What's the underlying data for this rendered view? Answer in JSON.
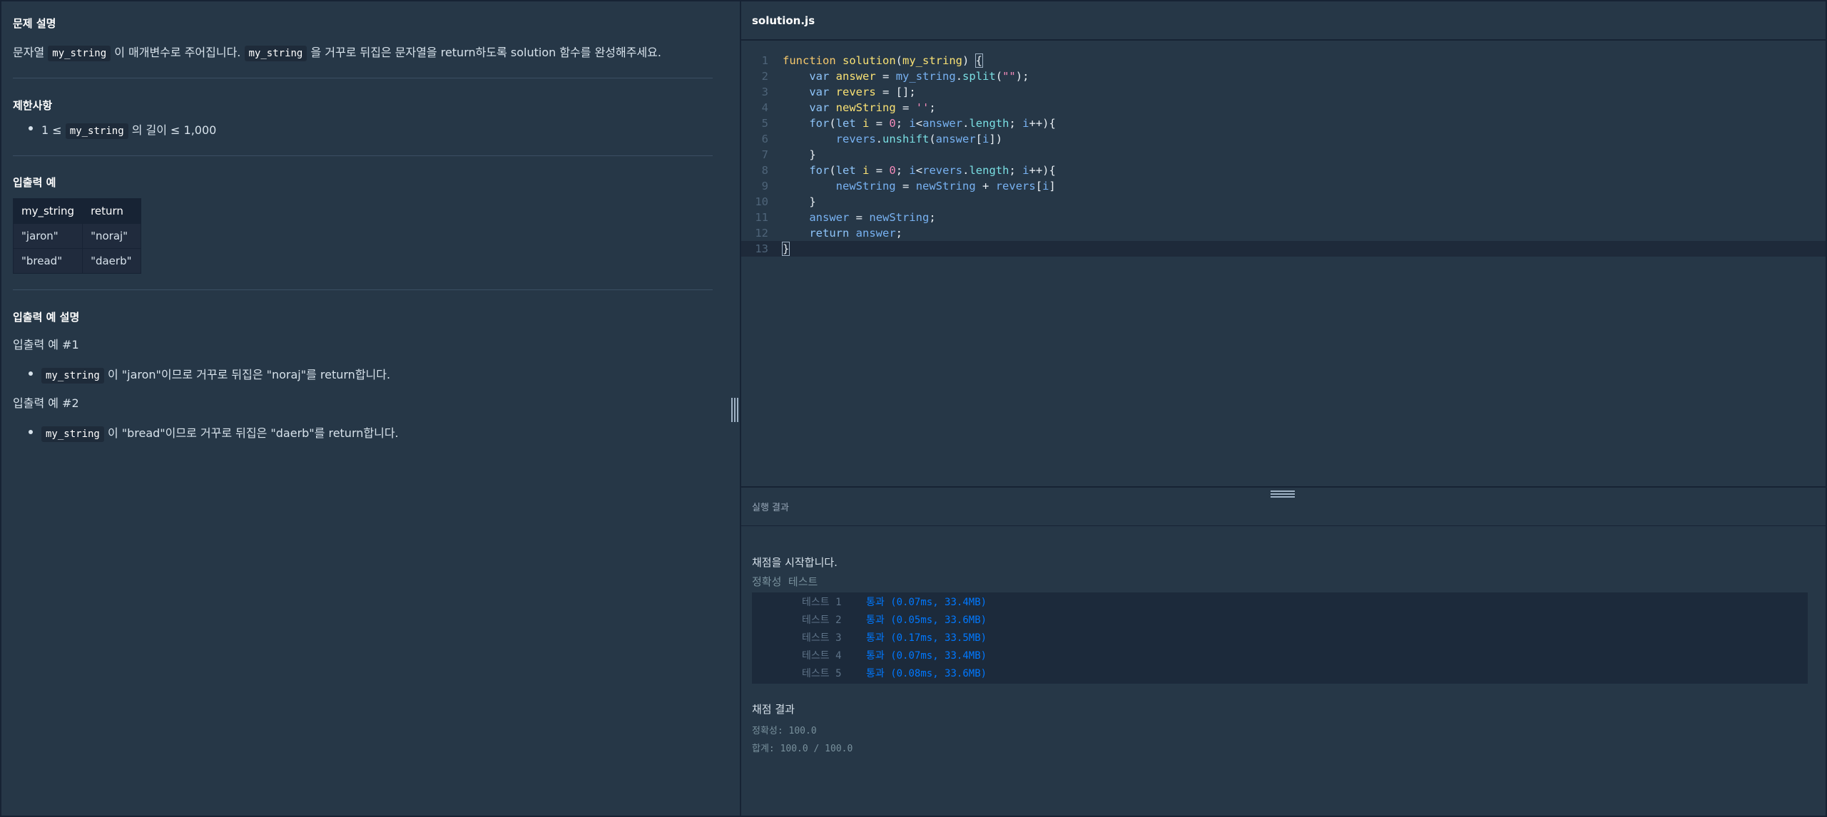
{
  "problem": {
    "description_title": "문제 설명",
    "description": {
      "p1": "문자열",
      "code1": "my_string",
      "p2": "이 매개변수로 주어집니다.",
      "code2": "my_string",
      "p3": "을 거꾸로 뒤집은 문자열을 return하도록 solution 함수를 완성해주세요."
    },
    "constraints_title": "제한사항",
    "constraint": {
      "prefix": "1 ≤",
      "code": "my_string",
      "suffix": "의 길이 ≤ 1,000"
    },
    "examples_title": "입출력 예",
    "table": {
      "headers": [
        "my_string",
        "return"
      ],
      "rows": [
        [
          "\"jaron\"",
          "\"noraj\""
        ],
        [
          "\"bread\"",
          "\"daerb\""
        ]
      ]
    },
    "explain_title": "입출력 예 설명",
    "explain": [
      {
        "subtitle": "입출력 예 #1",
        "code": "my_string",
        "text": "이 \"jaron\"이므로 거꾸로 뒤집은 \"noraj\"를 return합니다."
      },
      {
        "subtitle": "입출력 예 #2",
        "code": "my_string",
        "text": "이 \"bread\"이므로 거꾸로 뒤집은 \"daerb\"를 return합니다."
      }
    ]
  },
  "editor": {
    "filename": "solution.js",
    "line_numbers": [
      "1",
      "2",
      "3",
      "4",
      "5",
      "6",
      "7",
      "8",
      "9",
      "10",
      "11",
      "12",
      "13"
    ]
  },
  "result": {
    "title": "실행 결과",
    "start": "채점을 시작합니다.",
    "tabs": "정확성  테스트",
    "tests": [
      {
        "name": "테스트 1",
        "result": "통과 (0.07ms, 33.4MB)"
      },
      {
        "name": "테스트 2",
        "result": "통과 (0.05ms, 33.6MB)"
      },
      {
        "name": "테스트 3",
        "result": "통과 (0.17ms, 33.5MB)"
      },
      {
        "name": "테스트 4",
        "result": "통과 (0.07ms, 33.4MB)"
      },
      {
        "name": "테스트 5",
        "result": "통과 (0.08ms, 33.6MB)"
      }
    ],
    "score_title": "채점 결과",
    "accuracy": "정확성: 100.0",
    "total": "합계: 100.0 / 100.0"
  },
  "colors": {
    "background": "#263747",
    "pass": "#0078ff"
  }
}
